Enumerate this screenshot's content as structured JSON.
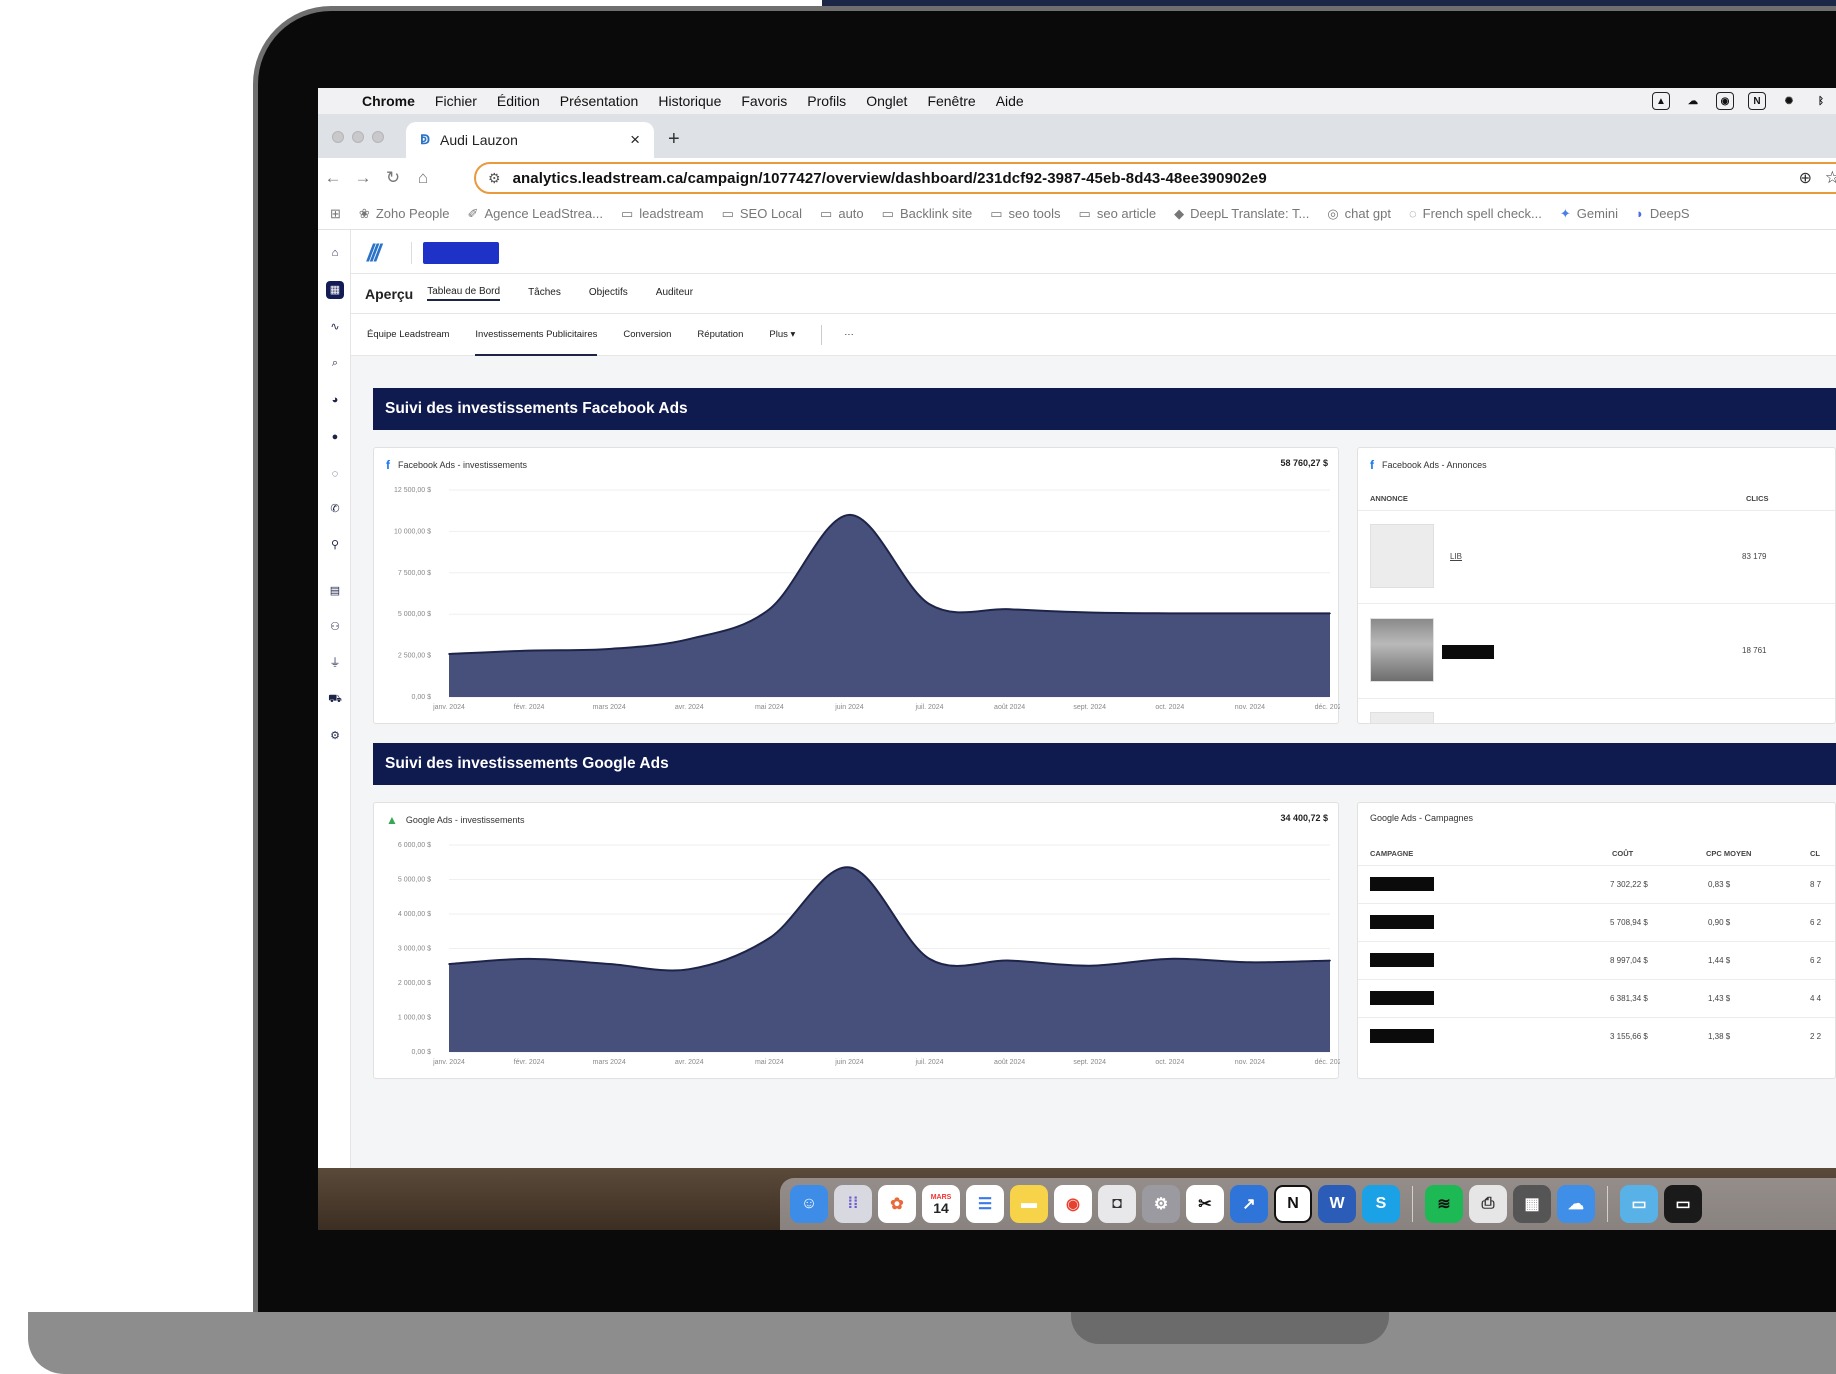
{
  "menubar": {
    "items": [
      "Chrome",
      "Fichier",
      "Édition",
      "Présentation",
      "Historique",
      "Favoris",
      "Profils",
      "Onglet",
      "Fenêtre",
      "Aide"
    ]
  },
  "browser": {
    "tab_title": "Audi Lauzon",
    "url": "analytics.leadstream.ca/campaign/1077427/overview/dashboard/231dcf92-3987-45eb-8d43-48ee390902e9"
  },
  "bookmarks": [
    {
      "label": "Zoho People",
      "icon": "zoho-icon"
    },
    {
      "label": "Agence LeadStrea...",
      "icon": "leadstream-icon"
    },
    {
      "label": "leadstream",
      "icon": "folder-icon"
    },
    {
      "label": "SEO Local",
      "icon": "folder-icon"
    },
    {
      "label": "auto",
      "icon": "folder-icon"
    },
    {
      "label": "Backlink site",
      "icon": "folder-icon"
    },
    {
      "label": "seo tools",
      "icon": "folder-icon"
    },
    {
      "label": "seo article",
      "icon": "folder-icon"
    },
    {
      "label": "DeepL Translate: T...",
      "icon": "deepl-icon"
    },
    {
      "label": "chat gpt",
      "icon": "chatgpt-icon"
    },
    {
      "label": "French spell check...",
      "icon": "spellcheck-icon"
    },
    {
      "label": "Gemini",
      "icon": "gemini-icon"
    },
    {
      "label": "DeepS",
      "icon": "deepseek-icon"
    }
  ],
  "app_nav": {
    "title": "Aperçu",
    "items": [
      "Tableau de Bord",
      "Tâches",
      "Objectifs",
      "Auditeur"
    ]
  },
  "subnav": {
    "items": [
      "Équipe Leadstream",
      "Investissements Publicitaires",
      "Conversion",
      "Réputation",
      "Plus ▾"
    ],
    "more": "···"
  },
  "facebook": {
    "section_title": "Suivi des investissements Facebook Ads",
    "chart_title": "Facebook Ads - investissements",
    "total": "58 760,27 $",
    "ads_title": "Facebook Ads - Annonces",
    "ads_columns": [
      "ANNONCE",
      "CLICS"
    ],
    "ads_rows": [
      {
        "name": "LIB",
        "clicks": "83 179"
      },
      {
        "name": "",
        "clicks": "18 761"
      }
    ]
  },
  "google": {
    "section_title": "Suivi des investissements Google Ads",
    "chart_title": "Google Ads - investissements",
    "total": "34 400,72 $",
    "campaigns_title": "Google Ads - Campagnes",
    "campaign_columns": [
      "CAMPAGNE",
      "COÛT",
      "CPC MOYEN",
      "CL"
    ],
    "campaign_rows": [
      {
        "cost": "7 302,22 $",
        "cpc": "0,83 $",
        "clicks": "8 7"
      },
      {
        "cost": "5 708,94 $",
        "cpc": "0,90 $",
        "clicks": "6 2"
      },
      {
        "cost": "8 997,04 $",
        "cpc": "1,44 $",
        "clicks": "6 2"
      },
      {
        "cost": "6 381,34 $",
        "cpc": "1,43 $",
        "clicks": "4 4"
      },
      {
        "cost": "3 155,66 $",
        "cpc": "1,38 $",
        "clicks": "2 2"
      }
    ]
  },
  "chart_data": [
    {
      "type": "area",
      "title": "Facebook Ads - investissements",
      "categories": [
        "janv. 2024",
        "févr. 2024",
        "mars 2024",
        "avr. 2024",
        "mai 2024",
        "juin 2024",
        "juil. 2024",
        "août 2024",
        "sept. 2024",
        "oct. 2024",
        "nov. 2024",
        "déc. 2024"
      ],
      "y_tick_labels": [
        "0,00 $",
        "2 500,00 $",
        "5 000,00 $",
        "7 500,00 $",
        "10 000,00 $",
        "12 500,00 $"
      ],
      "ylim": [
        0,
        12500
      ],
      "series": [
        {
          "values": [
            2600,
            2800,
            2900,
            3500,
            5300,
            11000,
            5600,
            5300,
            5100,
            5050,
            5050,
            5050
          ]
        }
      ],
      "color": "#46507a"
    },
    {
      "type": "area",
      "title": "Google Ads - investissements",
      "categories": [
        "janv. 2024",
        "févr. 2024",
        "mars 2024",
        "avr. 2024",
        "mai 2024",
        "juin 2024",
        "juil. 2024",
        "août 2024",
        "sept. 2024",
        "oct. 2024",
        "nov. 2024",
        "déc. 2024"
      ],
      "y_tick_labels": [
        "0,00 $",
        "1 000,00 $",
        "2 000,00 $",
        "3 000,00 $",
        "4 000,00 $",
        "5 000,00 $",
        "6 000,00 $"
      ],
      "ylim": [
        0,
        6000
      ],
      "series": [
        {
          "values": [
            2550,
            2700,
            2550,
            2400,
            3300,
            5350,
            2700,
            2650,
            2500,
            2700,
            2600,
            2650
          ]
        }
      ],
      "color": "#46507a"
    }
  ],
  "dock": {
    "calendar_month": "MARS",
    "calendar_day": "14",
    "apps": [
      "finder",
      "launchpad",
      "photos",
      "calendar",
      "reminders",
      "notes",
      "chrome",
      "screenshot",
      "settings",
      "capcut",
      "leadstream",
      "notion",
      "word",
      "skype",
      "spotify",
      "printer",
      "calculator",
      "weather",
      "folder",
      "screens"
    ]
  },
  "colors": {
    "section_header": "#0f1a4f",
    "chart_fill": "#46507a",
    "omnibox_border": "#e89a3c"
  }
}
